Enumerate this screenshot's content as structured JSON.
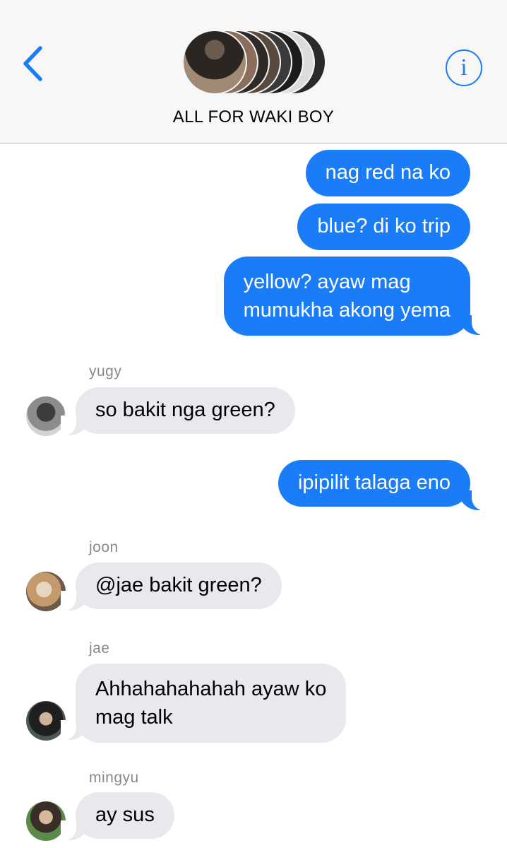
{
  "header": {
    "group_title": "ALL FOR WAKI BOY",
    "back_icon": "chevron-left-icon",
    "info_glyph": "i",
    "accent": "#1a7cf6"
  },
  "messages": [
    {
      "direction": "outgoing",
      "text": "nag red na ko"
    },
    {
      "direction": "outgoing",
      "text": "blue? di ko trip"
    },
    {
      "direction": "outgoing",
      "lines": [
        "yellow? ayaw mag",
        "mumukha akong yema"
      ]
    },
    {
      "direction": "incoming",
      "sender": "yugy",
      "text": "so bakit nga green?"
    },
    {
      "direction": "outgoing",
      "text": "ipipilit talaga eno"
    },
    {
      "direction": "incoming",
      "sender": "joon",
      "text": "@jae bakit green?"
    },
    {
      "direction": "incoming",
      "sender": "jae",
      "lines": [
        "Ahhahahahahah ayaw ko",
        "mag talk"
      ]
    },
    {
      "direction": "incoming",
      "sender": "mingyu",
      "text": "ay sus"
    }
  ],
  "colors": {
    "outgoing_bubble": "#1a7cf6",
    "incoming_bubble": "#e8e8ed",
    "sender_name": "#8a8a8e"
  }
}
